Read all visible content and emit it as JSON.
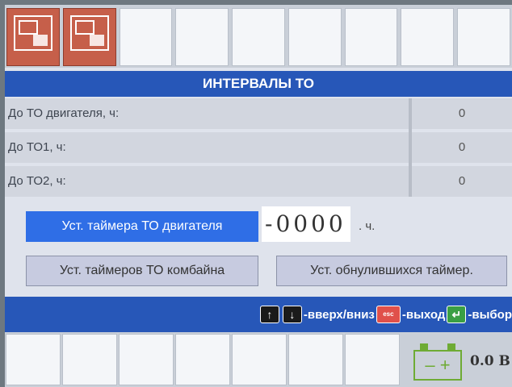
{
  "title": "ИНТЕРВАЛЫ ТО",
  "rows": [
    {
      "label": "До ТО двигателя, ч:",
      "value": "0"
    },
    {
      "label": "До ТО1, ч:",
      "value": "0"
    },
    {
      "label": "До ТО2, ч:",
      "value": "0"
    }
  ],
  "timer": {
    "button_label": "Уст. таймера ТО двигателя",
    "value": "-0000",
    "unit": ". ч."
  },
  "buttons": {
    "combine_timers": "Уст. таймеров ТО комбайна",
    "reset_timers": "Уст. обнулившихся таймер."
  },
  "hints": {
    "up_down": "-вверх/вниз",
    "esc_key": "esc",
    "exit": "-выход",
    "select": "-выбор"
  },
  "battery": {
    "symbol": "– +",
    "voltage": "0.0 В"
  },
  "colors": {
    "accent": "#2757b8",
    "active_button": "#2f6ee6",
    "tool_icon": "#c65f4a",
    "battery": "#6eab34"
  },
  "icons": [
    "settings-tool-icon",
    "config-tool-icon",
    "arrow-up-key-icon",
    "arrow-down-key-icon",
    "esc-key-icon",
    "enter-key-icon",
    "battery-icon"
  ]
}
